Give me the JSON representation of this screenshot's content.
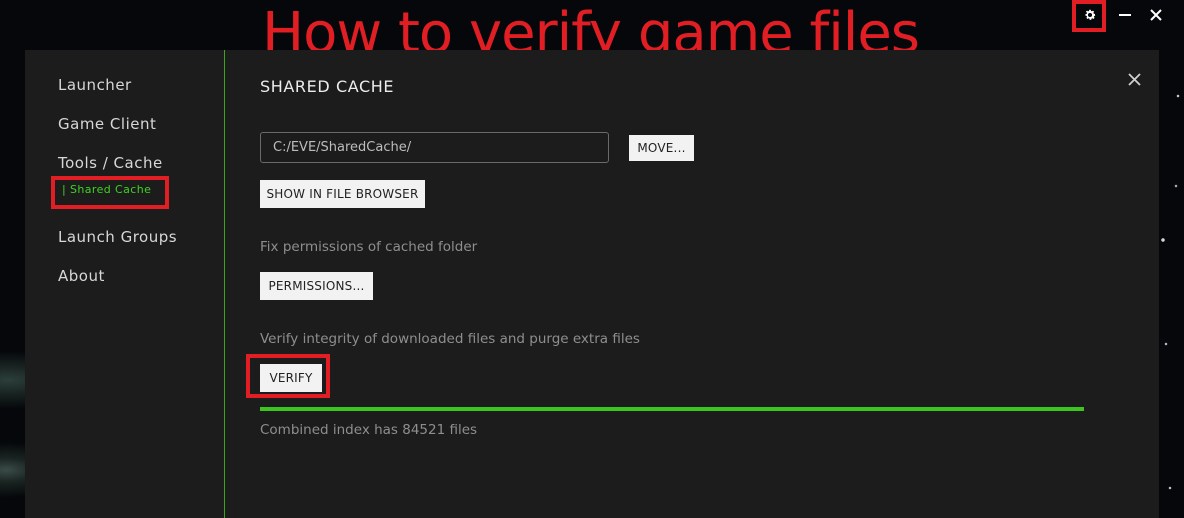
{
  "overlay": {
    "headline": "How to verify game files"
  },
  "window_controls": {
    "settings_icon": "gear-icon",
    "minimize_icon": "minimize-icon",
    "close_icon": "close-icon"
  },
  "sidebar": {
    "items": [
      {
        "label": "Launcher"
      },
      {
        "label": "Game Client"
      },
      {
        "label": "Tools / Cache"
      },
      {
        "label": "Launch Groups"
      },
      {
        "label": "About"
      }
    ],
    "sub_item": {
      "label": "| Shared Cache",
      "color": "#3ed320"
    }
  },
  "content": {
    "title": "SHARED CACHE",
    "path_input": {
      "value": "C:/EVE/SharedCache/"
    },
    "move_button": "MOVE...",
    "show_in_browser_button": "SHOW IN FILE BROWSER",
    "permissions_description": "Fix permissions of cached folder",
    "permissions_button": "PERMISSIONS...",
    "verify_description": "Verify integrity of downloaded files and purge extra files",
    "verify_button": "VERIFY",
    "progress": {
      "fraction": 1.0,
      "color": "#3cc41f"
    },
    "status_text": "Combined index has 84521 files"
  },
  "colors": {
    "highlight": "#e01e24",
    "accent": "#3ba51f",
    "panel_bg": "#1c1c1c"
  }
}
